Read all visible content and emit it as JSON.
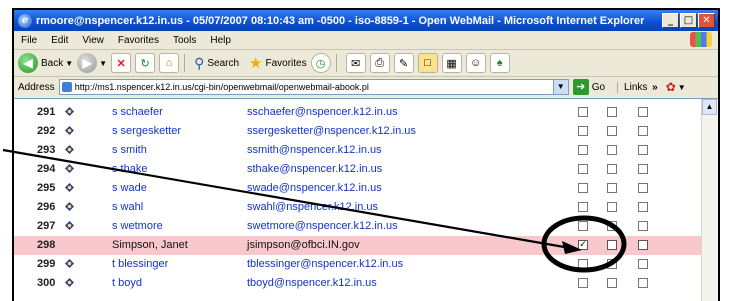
{
  "window": {
    "title": "rmoore@nspencer.k12.in.us - 05/07/2007 08:10:43 am -0500 - iso-8859-1 - Open WebMail - Microsoft Internet Explorer",
    "minimize": "_",
    "maximize": "7",
    "close": "×"
  },
  "menu": [
    "File",
    "Edit",
    "View",
    "Favorites",
    "Tools",
    "Help"
  ],
  "toolbar": {
    "back_label": "Back",
    "search_label": "Search",
    "favorites_label": "Favorites"
  },
  "addressbar": {
    "label": "Address",
    "url": "http://ms1.nspencer.k12.in.us/cgi-bin/openwebmail/openwebmail-abook.pl",
    "go_label": "Go",
    "links_label": "Links"
  },
  "rows": [
    {
      "num": "291",
      "name": "s schaefer",
      "email": "sschaefer@nspencer.k12.in.us",
      "checks": [
        false,
        false,
        false
      ],
      "highlight": false
    },
    {
      "num": "292",
      "name": "s sergesketter",
      "email": "ssergesketter@nspencer.k12.in.us",
      "checks": [
        false,
        false,
        false
      ],
      "highlight": false
    },
    {
      "num": "293",
      "name": "s smith",
      "email": "ssmith@nspencer.k12.in.us",
      "checks": [
        false,
        false,
        false
      ],
      "highlight": false
    },
    {
      "num": "294",
      "name": "s thake",
      "email": "sthake@nspencer.k12.in.us",
      "checks": [
        false,
        false,
        false
      ],
      "highlight": false
    },
    {
      "num": "295",
      "name": "s wade",
      "email": "swade@nspencer.k12.in.us",
      "checks": [
        false,
        false,
        false
      ],
      "highlight": false
    },
    {
      "num": "296",
      "name": "s wahl",
      "email": "swahl@nspencer.k12.in.us",
      "checks": [
        false,
        false,
        false
      ],
      "highlight": false
    },
    {
      "num": "297",
      "name": "s wetmore",
      "email": "swetmore@nspencer.k12.in.us",
      "checks": [
        false,
        false,
        false
      ],
      "highlight": false
    },
    {
      "num": "298",
      "name": "Simpson, Janet",
      "email": "jsimpson@ofbci.IN.gov",
      "checks": [
        true,
        false,
        false
      ],
      "highlight": true
    },
    {
      "num": "299",
      "name": "t blessinger",
      "email": "tblessinger@nspencer.k12.in.us",
      "checks": [
        false,
        false,
        false
      ],
      "highlight": false
    },
    {
      "num": "300",
      "name": "t boyd",
      "email": "tboyd@nspencer.k12.in.us",
      "checks": [
        false,
        false,
        false
      ],
      "highlight": false
    }
  ],
  "colors": {
    "link": "#1234c6",
    "highlight_row": "#f8c8cc",
    "titlebar": "#0a4fd4"
  }
}
